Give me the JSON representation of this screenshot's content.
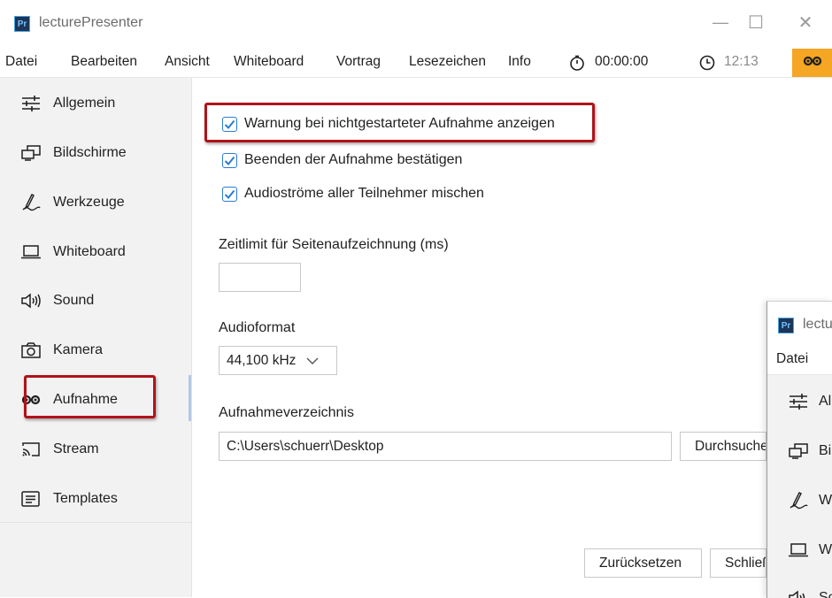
{
  "window": {
    "app_icon_text": "Pr",
    "title": "lecturePresenter",
    "controls": {
      "minimize": "—",
      "maximize": "☐",
      "close": "✕"
    }
  },
  "menu": {
    "items": [
      "Datei",
      "Bearbeiten",
      "Ansicht",
      "Whiteboard",
      "Vortrag",
      "Lesezeichen",
      "Info"
    ],
    "duration_timer": "00:00:00",
    "clock": "12:13",
    "record_indicator_color": "#f5a623"
  },
  "sidebar": {
    "items": [
      {
        "label": "Allgemein",
        "icon": "sliders-icon"
      },
      {
        "label": "Bildschirme",
        "icon": "monitors-icon"
      },
      {
        "label": "Werkzeuge",
        "icon": "pen-icon"
      },
      {
        "label": "Whiteboard",
        "icon": "laptop-icon"
      },
      {
        "label": "Sound",
        "icon": "speaker-icon"
      },
      {
        "label": "Kamera",
        "icon": "camera-icon"
      },
      {
        "label": "Aufnahme",
        "icon": "tape-icon"
      },
      {
        "label": "Stream",
        "icon": "cast-icon"
      },
      {
        "label": "Templates",
        "icon": "template-icon"
      }
    ],
    "selected": "Aufnahme"
  },
  "settings": {
    "checkboxes": [
      {
        "label": "Warnung bei nichtgestarteter Aufnahme anzeigen",
        "checked": true
      },
      {
        "label": "Beenden der Aufnahme bestätigen",
        "checked": true
      },
      {
        "label": "Audioströme aller Teilnehmer mischen",
        "checked": true
      }
    ],
    "page_time_limit": {
      "label": "Zeitlimit für Seitenaufzeichnung (ms)",
      "value": ""
    },
    "audio_format": {
      "label": "Audioformat",
      "value": "44,100 kHz"
    },
    "recording_dir": {
      "label": "Aufnahmeverzeichnis",
      "value": "C:\\Users\\schuerr\\Desktop",
      "browse_label": "Durchsuchen"
    },
    "buttons": {
      "reset": "Zurücksetzen",
      "close": "Schließen"
    }
  },
  "overlay_window": {
    "app_icon_text": "Pr",
    "title": "lecturePresenter",
    "menu_first": "Datei",
    "items": [
      "Allgemein",
      "Bildschirme",
      "Werkzeuge",
      "Whiteboard",
      "Sound"
    ]
  },
  "colors": {
    "accent": "#2b7bd1",
    "highlight": "#b0131a",
    "sidebar_bg": "#f2f2f2"
  }
}
